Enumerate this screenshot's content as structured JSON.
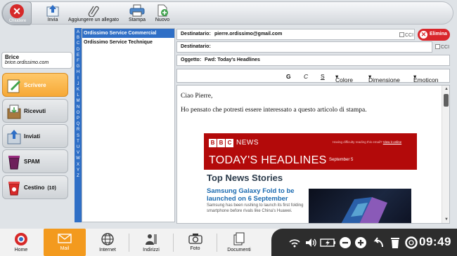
{
  "toolbar": {
    "close_label": "Chiudere",
    "buttons": [
      {
        "label": "Invia",
        "icon": "send-icon"
      },
      {
        "label": "Aggiungere un allegato",
        "icon": "paperclip-icon"
      },
      {
        "label": "Stampa",
        "icon": "printer-icon"
      },
      {
        "label": "Nuovo",
        "icon": "new-document-icon"
      }
    ]
  },
  "user": {
    "name": "Brice",
    "email": "brice.ordissimo.com"
  },
  "folders": [
    {
      "label": "Scrivere",
      "icon": "write-icon"
    },
    {
      "label": "Ricevuti",
      "icon": "inbox-icon"
    },
    {
      "label": "Inviati",
      "icon": "sent-icon"
    },
    {
      "label": "SPAM",
      "icon": "spam-icon"
    },
    {
      "label": "Cestino",
      "count": "(10)",
      "icon": "trash-icon"
    }
  ],
  "alphabet": [
    "A",
    "B",
    "C",
    "D",
    "E",
    "F",
    "G",
    "H",
    "I",
    "J",
    "K",
    "L",
    "M",
    "N",
    "O",
    "P",
    "Q",
    "R",
    "S",
    "T",
    "U",
    "V",
    "W",
    "X",
    "Y",
    "Z"
  ],
  "contacts": [
    "Ordissimo Service Commercial",
    "Ordissimo Service Technique"
  ],
  "compose": {
    "to_label": "Destinatario:",
    "to_value": "pierre.ordissimo@gmail.com",
    "cc_label": "Destinatario:",
    "cci": "CCI",
    "delete_label": "Elimina",
    "subject_label": "Oggetto:",
    "subject_value": "Fwd: Today's Headlines",
    "format": {
      "bold": "G",
      "italic": "C",
      "underline": "S",
      "color": "Colore",
      "size": "Dimensione",
      "emoticon": "Emoticon"
    },
    "greeting": "Ciao Pierre,",
    "message": "Ho pensato che potresti essere interessato a questo articolo di stampa."
  },
  "newsletter": {
    "brand": "NEWS",
    "notice": "Having difficulty reading this email?",
    "notice_link": "View it online",
    "headline": "TODAY'S HEADLINES",
    "date": "September 5",
    "section": "Top News Stories",
    "story_title": "Samsung Galaxy Fold to be launched on 6 September",
    "story_desc": "Samsung has been rushing to launch its first folding smartphone before rivals like China's Huawei."
  },
  "taskbar": [
    {
      "label": "Home",
      "icon": "home-icon"
    },
    {
      "label": "Mail",
      "icon": "mail-icon"
    },
    {
      "label": "Internet",
      "icon": "globe-icon"
    },
    {
      "label": "Indirizzi",
      "icon": "address-book-icon"
    },
    {
      "label": "Foto",
      "icon": "camera-icon"
    },
    {
      "label": "Documenti",
      "icon": "documents-icon"
    }
  ],
  "clock": "09:49",
  "colors": {
    "accent": "#f39a1e",
    "brand_blue": "#2f6fc6",
    "danger": "#d9262b",
    "bbc_red": "#b30a0a"
  }
}
